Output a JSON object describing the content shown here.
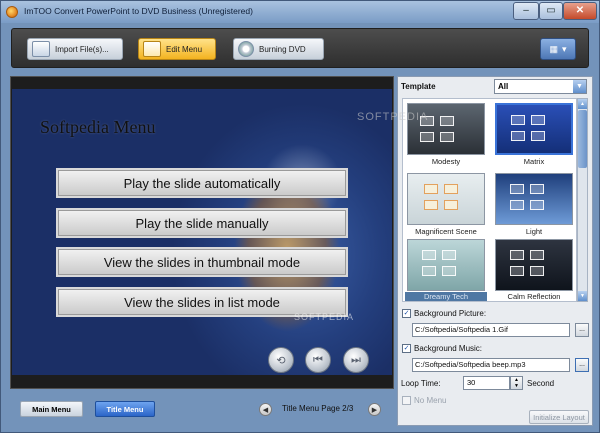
{
  "window": {
    "title": "ImTOO Convert PowerPoint to DVD Business (Unregistered)",
    "minimize": "–",
    "maximize": "▭",
    "close": "✕"
  },
  "toolbar": {
    "import_label": "Import File(s)...",
    "edit_label": "Edit Menu",
    "burn_label": "Burning DVD",
    "view_icon": "▦",
    "view_dropdown": "▾"
  },
  "preview": {
    "menu_title": "Softpedia Menu",
    "menu_items": [
      "Play the slide automatically",
      "Play the slide manually",
      "View the slides in thumbnail mode",
      "View the slides in list mode"
    ],
    "nav_buttons": [
      "⟲",
      "⏮",
      "⏭"
    ],
    "watermark": "SOFTPEDIA"
  },
  "bottom": {
    "main_menu": "Main Menu",
    "title_menu": "Title Menu",
    "page_info": "Title Menu Page 2/3",
    "prev": "◀",
    "next": "▶"
  },
  "panel": {
    "template_label": "Template",
    "template_value": "All",
    "templates": [
      "Modesty",
      "Matrix",
      "Magnificent Scene",
      "Light",
      "Dreamy Tech",
      "Calm Reflection"
    ],
    "bg_picture_label": "Background Picture:",
    "bg_picture_checked": "✓",
    "bg_picture_value": "C:/Softpedia/Softpedia 1.Gif",
    "bg_music_label": "Background Music:",
    "bg_music_checked": "✓",
    "bg_music_value": "C:/Softpedia/Softpedia beep.mp3",
    "browse": "...",
    "loop_label": "Loop Time:",
    "loop_value": "30",
    "loop_unit": "Second",
    "no_menu_label": "No Menu",
    "init_layout": "Initialize Layout",
    "watermark": "SOFTPEDIA"
  }
}
